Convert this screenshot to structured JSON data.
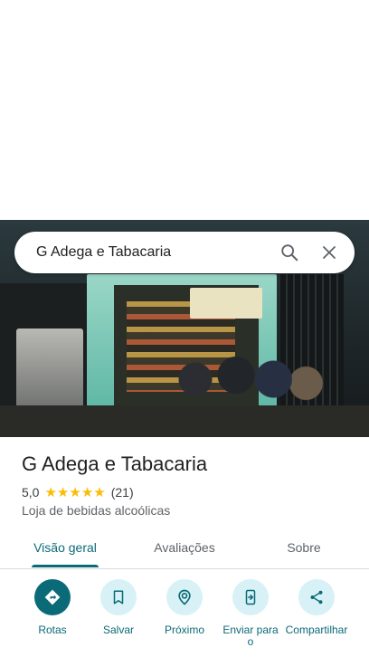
{
  "search": {
    "query": "G Adega e Tabacaria"
  },
  "place": {
    "name": "G Adega e Tabacaria",
    "rating": "5,0",
    "stars": 5,
    "review_count": "(21)",
    "category": "Loja de bebidas alcoólicas"
  },
  "tabs": [
    {
      "label": "Visão geral",
      "active": true
    },
    {
      "label": "Avaliações",
      "active": false
    },
    {
      "label": "Sobre",
      "active": false
    }
  ],
  "actions": [
    {
      "label": "Rotas",
      "icon": "directions-icon"
    },
    {
      "label": "Salvar",
      "icon": "bookmark-icon"
    },
    {
      "label": "Próximo",
      "icon": "nearby-icon"
    },
    {
      "label": "Enviar para o",
      "icon": "send-to-phone-icon"
    },
    {
      "label": "Compartilhar",
      "icon": "share-icon"
    }
  ],
  "colors": {
    "accent": "#0b6a77",
    "chip": "#d7f1f6",
    "star": "#fbbc04"
  }
}
